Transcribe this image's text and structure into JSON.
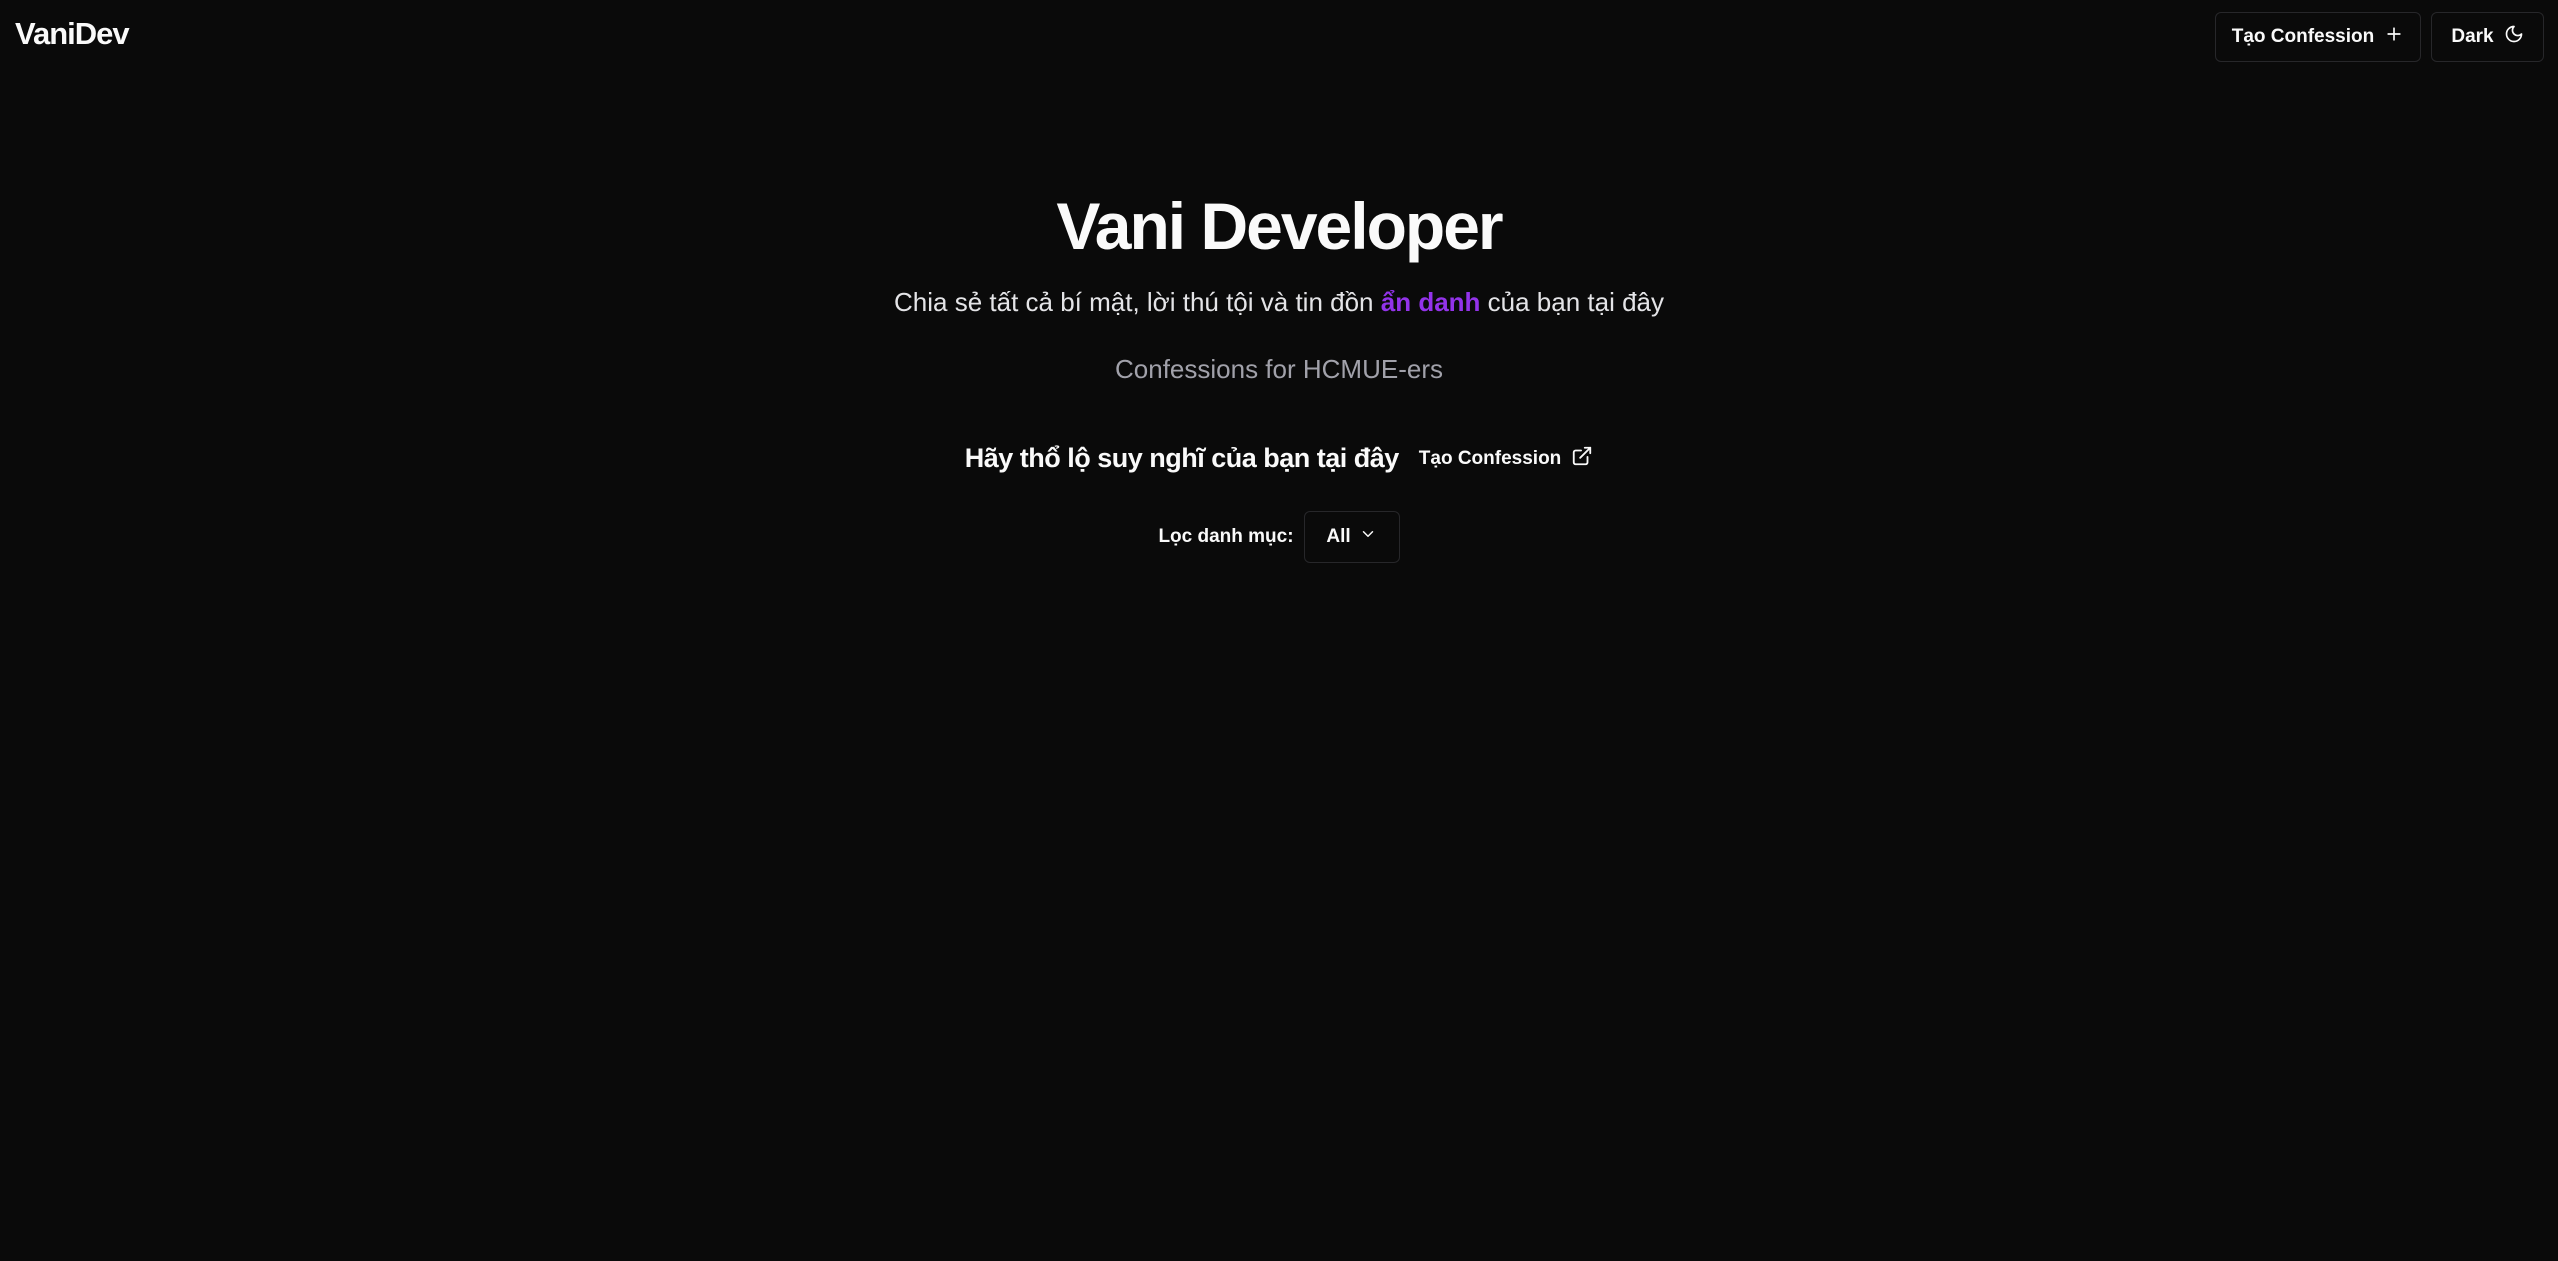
{
  "header": {
    "logo": "VaniDev",
    "create_button_label": "Tạo Confession",
    "theme_button_label": "Dark"
  },
  "hero": {
    "title": "Vani Developer",
    "subtitle_before": "Chia sẻ tất cả bí mật, lời thú tội và tin đồn ",
    "subtitle_accent": "ẩn danh",
    "subtitle_after": " của bạn tại đây",
    "tagline": "Confessions for HCMUE-ers"
  },
  "cta": {
    "text": "Hãy thổ lộ suy nghĩ của bạn tại đây",
    "link_label": "Tạo Confession"
  },
  "filter": {
    "label": "Lọc danh mục:",
    "selected": "All"
  },
  "colors": {
    "background": "#0a0a0a",
    "accent": "#9333ea",
    "border": "#27272a"
  },
  "icons": {
    "create": "plus-icon",
    "theme": "moon-icon",
    "cta_link": "external-link-icon",
    "select": "chevron-down-icon"
  }
}
